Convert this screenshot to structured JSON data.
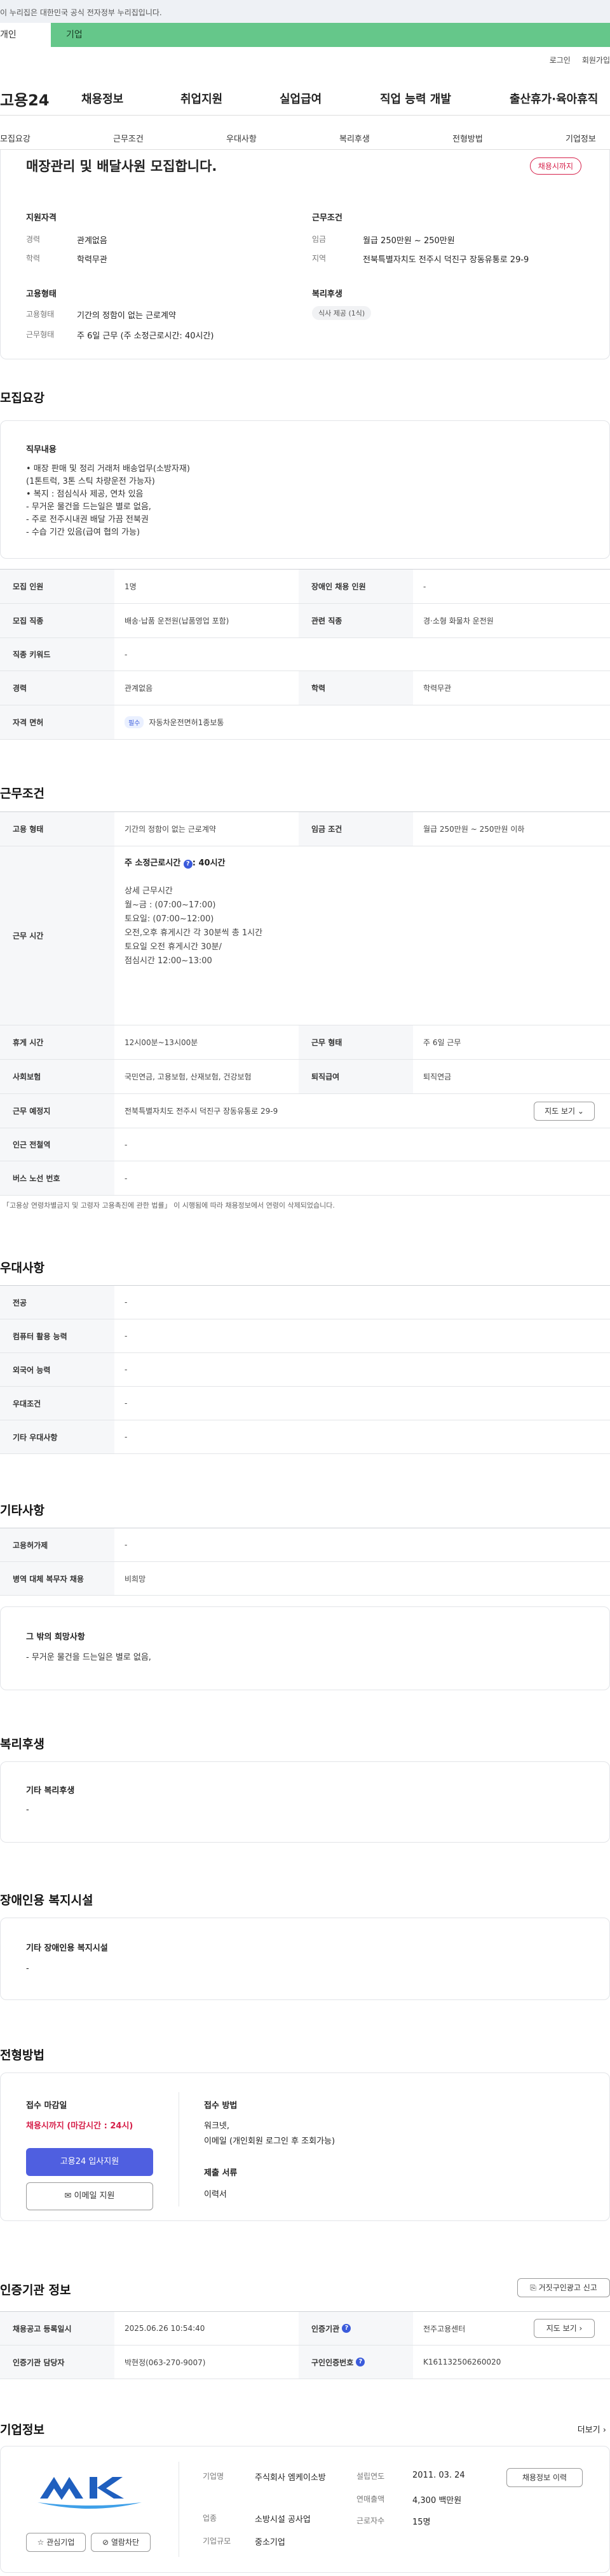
{
  "gov_banner": "이 누리집은 대한민국 공식 전자정부 누리집입니다.",
  "top_tabs": {
    "personal": "개인",
    "company": "기업"
  },
  "util": {
    "login": "로그인",
    "signup": "회원가입"
  },
  "gnb": {
    "logo": "고용24",
    "menus": [
      "채용정보",
      "취업지원",
      "실업급여",
      "직업 능력 개발",
      "출산휴가·육아휴직"
    ]
  },
  "snb": [
    "모집요강",
    "근무조건",
    "우대사항",
    "복리후생",
    "전형방법",
    "기업정보"
  ],
  "summary": {
    "title": "매장관리 및 배달사원 모집합니다.",
    "badge": "채용시까지",
    "support_title": "지원자격",
    "career_label": "경력",
    "career": "관계없음",
    "edu_label": "학력",
    "edu": "학력무관",
    "cond_title": "근무조건",
    "wage_label": "임금",
    "wage": "월급 250만원 ~ 250만원",
    "region_label": "지역",
    "region": "전북특별자치도 전주시 덕진구 장동유통로 29-9",
    "emp_title": "고용형태",
    "emp_type_label": "고용형태",
    "emp_type": "기간의 정함이 없는 근로계약",
    "work_label": "근무형태",
    "work": "주 6일 근무 (주 소정근로시간: 40시간)",
    "welfare_title": "복리후생",
    "welfare_tag": "식사 제공 (1식)"
  },
  "recruit": {
    "heading": "모집요강",
    "duty_title": "직무내용",
    "duty_lines": [
      "• 매장 판매 및 정리 거래처 배송업무(소방자재)",
      "(1톤트럭, 3톤 스틱 차량운전 가능자)",
      "• 복지 : 점심식사 제공, 연차 있음",
      "- 무거운 물건을 드는일은 별로 없음,",
      "- 주로 전주시내권 배달 가끔 전북권",
      "- 수습 기간 있음(급여 협의 가능)"
    ],
    "rows": [
      {
        "l1": "모집 인원",
        "v1": "1명",
        "l2": "장애인 채용 인원",
        "v2": "-"
      },
      {
        "l1": "모집 직종",
        "v1": "배송·납품 운전원(납품영업 포함)",
        "l2": "관련 직종",
        "v2": "경·소형 화물차 운전원"
      },
      {
        "l1": "직종 키워드",
        "v1": "-"
      },
      {
        "l1": "경력",
        "v1": "관계없음",
        "l2": "학력",
        "v2": "학력무관"
      },
      {
        "l1": "자격 면허",
        "tag": "필수",
        "v1": "자동차운전면허1종보통"
      }
    ]
  },
  "conditions": {
    "heading": "근무조건",
    "emp_label": "고용 형태",
    "emp": "기간의 정함이 없는 근로계약",
    "wage_label": "임금 조건",
    "wage": "월급 250만원 ~ 250만원 이하",
    "time_label": "근무 시간",
    "time_title": "주 소정근로시간",
    "time_hours": ": 40시간",
    "time_lines": [
      "상세 근무시간",
      "월~금 : (07:00~17:00)",
      "토요일: (07:00~12:00)",
      "오전,오후 휴게시간 각 30분씩 총 1시간",
      "토요일 오전 휴게시간 30분/",
      "점심시간 12:00~13:00"
    ],
    "break_label": "휴게 시간",
    "break": "12시00분~13시00분",
    "form_label": "근무 형태",
    "form": "주 6일 근무",
    "ins_label": "사회보험",
    "ins": "국민연금, 고용보험, 산재보험, 건강보험",
    "retire_label": "퇴직급여",
    "retire": "퇴직연금",
    "place_label": "근무 예정지",
    "place": "전북특별자치도 전주시 덕진구 장동유통로 29-9",
    "map_btn": "지도 보기",
    "subway_label": "인근 전철역",
    "subway": "-",
    "bus_label": "버스 노선 번호",
    "bus": "-",
    "note": "「고용상 연령차별금지 및 고령자 고용촉진에 관한 법률」 이 시행됨에 따라 채용정보에서 연령이 삭제되었습니다."
  },
  "pref": {
    "heading": "우대사항",
    "rows": [
      {
        "l": "전공",
        "v": "-"
      },
      {
        "l": "컴퓨터 활용 능력",
        "v": "-"
      },
      {
        "l": "외국어 능력",
        "v": "-"
      },
      {
        "l": "우대조건",
        "v": "-"
      },
      {
        "l": "기타 우대사항",
        "v": "-"
      }
    ]
  },
  "etc": {
    "heading": "기타사항",
    "rows": [
      {
        "l": "고용허가제",
        "v": "-"
      },
      {
        "l": "병역 대체 복무자 채용",
        "v": "비희망"
      }
    ],
    "wish_title": "그 밖의 희망사항",
    "wish": "- 무거운 물건을 드는일은 별로 없음,"
  },
  "welfare": {
    "heading": "복리후생",
    "title": "기타 복리후생",
    "value": "-"
  },
  "disabled": {
    "heading": "장애인용 복지시설",
    "title": "기타 장애인용 복지시설",
    "value": "-"
  },
  "apply": {
    "heading": "전형방법",
    "deadline_title": "접수 마감일",
    "deadline": "채용시까지 (마감시간 : 24시)",
    "apply_btn": "고용24 입사지원",
    "email_btn": "이메일 지원",
    "method_title": "접수 방법",
    "method1": "워크넷,",
    "method2": "이메일 (개인회원 로그인 후 조회가능)",
    "docs_title": "제출 서류",
    "docs": "이력서"
  },
  "agency": {
    "heading": "인증기관 정보",
    "report_btn": "거짓구인광고 신고",
    "reg_label": "채용공고 등록일시",
    "reg": "2025.06.26 10:54:40",
    "org_label": "인증기관",
    "org": "전주고용센터",
    "map_btn": "지도 보기",
    "manager_label": "인증기관 담당자",
    "manager": "박현정(063-270-9007)",
    "no_label": "구인인증번호",
    "no": "K161132506260020"
  },
  "company": {
    "heading": "기업정보",
    "more": "더보기",
    "name_label": "기업명",
    "name": "주식회사 엠케이소방",
    "industry_label": "업종",
    "industry": "소방시설 공사업",
    "size_label": "기업규모",
    "size": "중소기업",
    "founded_label": "설립연도",
    "founded": "2011. 03. 24",
    "sales_label": "연매출액",
    "sales": "4,300 백만원",
    "employees_label": "근로자수",
    "employees": "15명",
    "jobs_btn": "채용정보 이력",
    "fav_btn": "관심기업",
    "block_btn": "열람차단"
  }
}
